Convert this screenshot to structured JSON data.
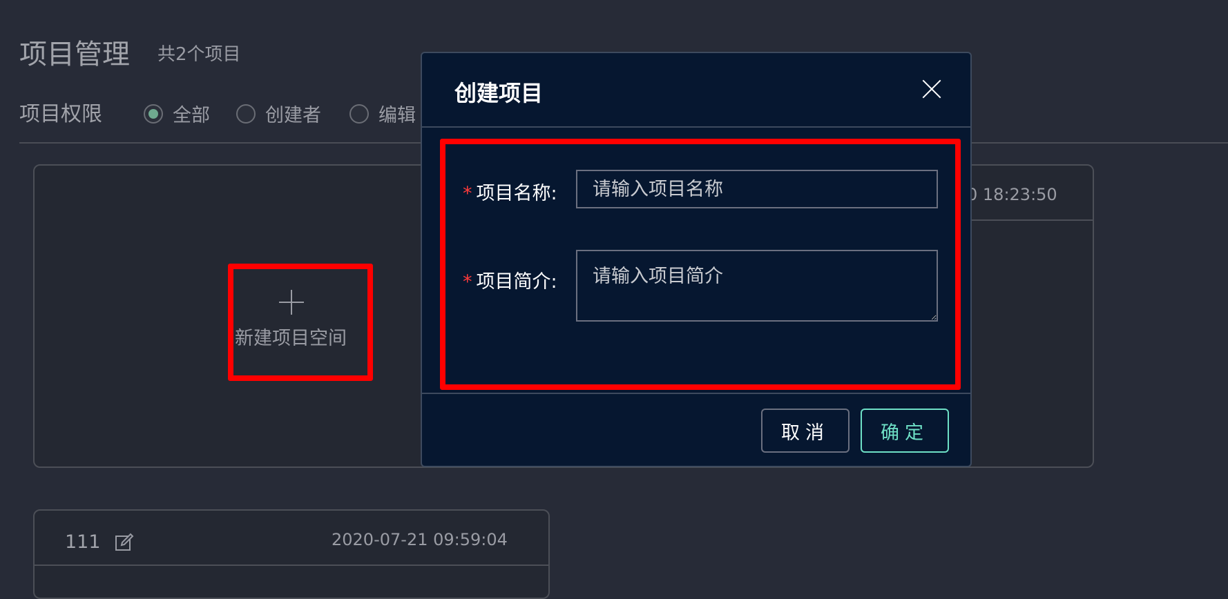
{
  "header": {
    "title": "项目管理",
    "count": "共2个项目"
  },
  "filter": {
    "label": "项目权限",
    "options": [
      {
        "label": "全部",
        "selected": true
      },
      {
        "label": "创建者",
        "selected": false
      },
      {
        "label": "编辑",
        "selected": false
      }
    ]
  },
  "cards": {
    "new_space_label": "新建项目空间",
    "right_card_time": "0 18:23:50",
    "project_111": {
      "name": "111",
      "time": "2020-07-21 09:59:04"
    }
  },
  "modal": {
    "title": "创建项目",
    "name_field": {
      "label": "项目名称:",
      "placeholder": "请输入项目名称",
      "value": ""
    },
    "desc_field": {
      "label": "项目简介:",
      "placeholder": "请输入项目简介",
      "value": ""
    },
    "required_mark": "*",
    "cancel_label": "取消",
    "ok_label": "确定"
  },
  "colors": {
    "background": "#272b37",
    "modal_background": "#061730",
    "highlight": "#ff0000",
    "accent": "#6ee0c6",
    "radio_selected": "#6ea98f"
  }
}
